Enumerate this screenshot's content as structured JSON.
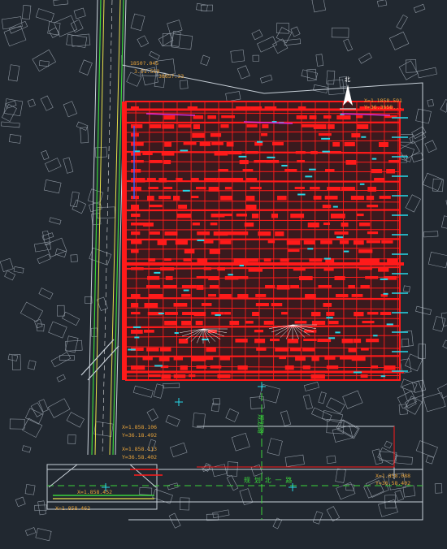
{
  "drawing": {
    "background": "#212830",
    "colors": {
      "basemap": "#9aa3ad",
      "grid_red": "#ff1a1a",
      "road_yellow": "#e8e04a",
      "road_green": "#3ad43a",
      "cyan": "#28d8e8",
      "orange_text": "#e8a33a",
      "white": "#ffffff",
      "magenta": "#d92cd9",
      "blue": "#3a5cff"
    },
    "coordinates": [
      {
        "id": "top-left-1",
        "text": "1850?.045"
      },
      {
        "id": "top-left-2",
        "text": "3.51.559"
      },
      {
        "id": "top-left-3",
        "text": "3865?.33"
      },
      {
        "id": "top-right-1",
        "text": "X=1.1858.591"
      },
      {
        "id": "top-right-2",
        "text": "Y=36.3658..."
      },
      {
        "id": "mid-left-1",
        "text": "X=1.858.106"
      },
      {
        "id": "mid-left-2",
        "text": "Y=36.18.492"
      },
      {
        "id": "mid-left-3",
        "text": "X=1.858.113"
      },
      {
        "id": "mid-left-4",
        "text": "Y=36.58.402"
      },
      {
        "id": "bottom-right-1",
        "text": "X=1.858.088"
      },
      {
        "id": "bottom-right-2",
        "text": "Y=36.58.402"
      },
      {
        "id": "bottom-left-1",
        "text": "X=1.858.452"
      },
      {
        "id": "bottom-left-2",
        "text": "X=1.858.462"
      }
    ],
    "road_label": "规 划 北 一 路",
    "road_label_vertical": "规划路",
    "north_label": "北"
  }
}
